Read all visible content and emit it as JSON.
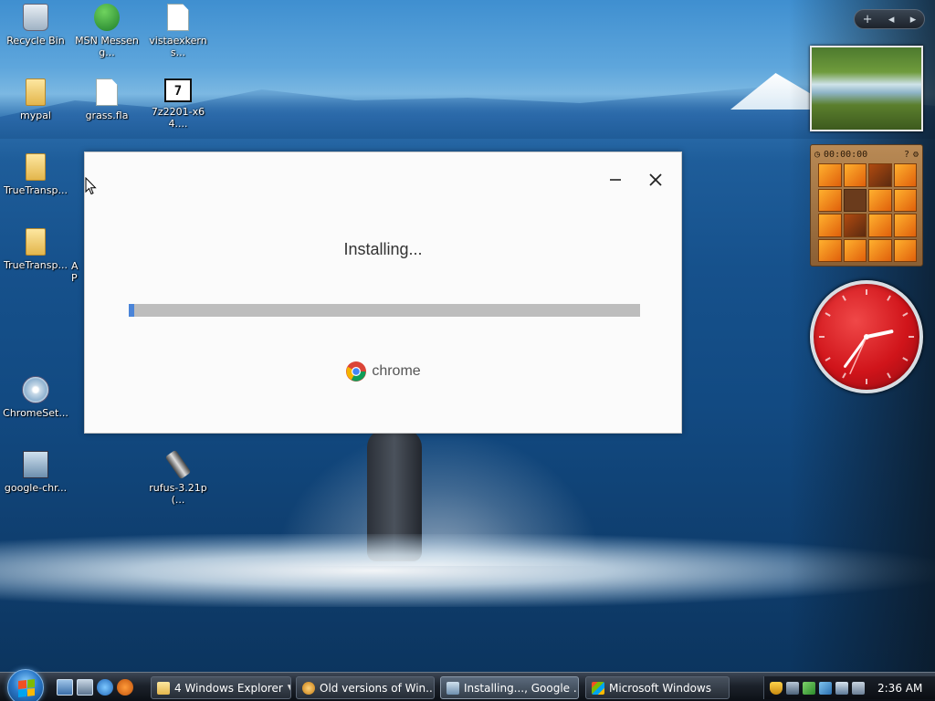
{
  "desktop": {
    "icons": [
      {
        "label": "Recycle Bin",
        "icon": "recycle-bin-icon"
      },
      {
        "label": "MSN Messeng...",
        "icon": "msn-messenger-icon"
      },
      {
        "label": "vistaexkerns...",
        "icon": "document-icon"
      },
      {
        "label": "mypal",
        "icon": "folder-icon"
      },
      {
        "label": "grass.fla",
        "icon": "document-icon"
      },
      {
        "label": "7z2201-x64....",
        "icon": "7zip-installer-icon"
      },
      {
        "label": "TrueTransp...",
        "icon": "folder-icon"
      },
      {
        "label": "TrueTransp...",
        "icon": "folder-icon"
      },
      {
        "label": "ChromeSet...",
        "icon": "setup-cd-icon"
      },
      {
        "label": "google-chr...",
        "icon": "setup-program-icon"
      },
      {
        "label": "rufus-3.21p(...",
        "icon": "usb-drive-icon"
      }
    ],
    "partial_label": "A\nP"
  },
  "gadgets": {
    "puzzle_timer": "00:00:00",
    "puzzle_help": "?",
    "clock_time": {
      "hour": 2,
      "minute": 36,
      "second": 34
    }
  },
  "installer": {
    "status_text": "Installing...",
    "progress": 0.01,
    "brand_text": "chrome",
    "colors": {
      "progress_fill": "#4a84d8",
      "progress_track": "#bdbdbd"
    }
  },
  "taskbar": {
    "buttons": [
      {
        "label": "4 Windows Explorer",
        "has_caret": true,
        "active": false
      },
      {
        "label": "Old versions of Win...",
        "has_caret": false,
        "active": false
      },
      {
        "label": "Installing..., Google ...",
        "has_caret": false,
        "active": true
      },
      {
        "label": "Microsoft Windows",
        "has_caret": false,
        "active": false
      }
    ],
    "clock": "2:36 AM"
  },
  "sidebar": {
    "add_label": "+",
    "prev_label": "◂",
    "next_label": "▸"
  }
}
